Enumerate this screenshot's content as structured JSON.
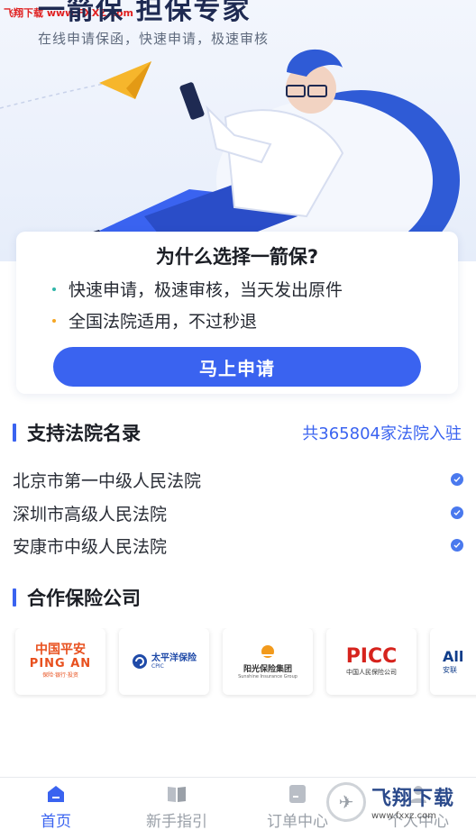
{
  "watermark_top": "飞翔下载 www.FXXZ.com",
  "hero": {
    "title": "一箭保 担保专家",
    "subtitle": "在线申请保函，快速申请，极速审核"
  },
  "why": {
    "title": "为什么选择一箭保?",
    "items": [
      {
        "text": "快速申请，极速审核，当天发出原件",
        "dot_color": "#2fb5a8"
      },
      {
        "text": "全国法院适用，不过秒退",
        "dot_color": "#f5a623"
      }
    ],
    "button": "马上申请"
  },
  "courts": {
    "title": "支持法院名录",
    "count_text": "共365804家法院入驻",
    "list": [
      "北京市第一中级人民法院",
      "深圳市高级人民法院",
      "安康市中级人民法院"
    ]
  },
  "insurers": {
    "title": "合作保险公司",
    "logos": [
      {
        "main": "中国平安",
        "en": "PING AN",
        "sub": "保险·银行·投资"
      },
      {
        "main": "太平洋保险",
        "en": "CPIC"
      },
      {
        "main": "阳光保险集团",
        "en": "Sunshine Insurance Group"
      },
      {
        "main": "PICC",
        "sub": "中国人民保险公司"
      },
      {
        "main": "All",
        "sub": "安联"
      }
    ]
  },
  "tabs": [
    {
      "label": "首页",
      "icon": "home-icon",
      "active": true
    },
    {
      "label": "新手指引",
      "icon": "book-icon",
      "active": false
    },
    {
      "label": "订单中心",
      "icon": "order-icon",
      "active": false
    },
    {
      "label": "个人中心",
      "icon": "user-icon",
      "active": false
    }
  ],
  "watermark_bottom": {
    "name": "飞翔下载",
    "url": "www.fxxz.com"
  },
  "colors": {
    "accent": "#3a63f0",
    "check": "#4a79ee"
  }
}
